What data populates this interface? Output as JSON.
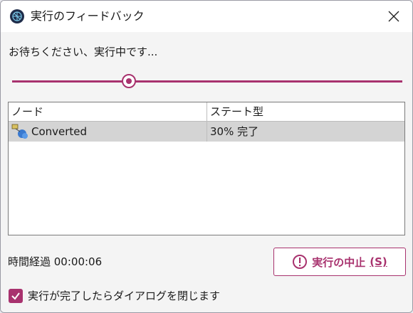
{
  "window": {
    "title": "実行のフィードバック",
    "app_icon": "globe-icon",
    "close_icon": "close-icon"
  },
  "message": "お待ちください、実行中です...",
  "progress": {
    "value": 0.3
  },
  "table": {
    "columns": [
      "ノード",
      "ステート型"
    ],
    "rows": [
      {
        "node": "Converted",
        "state": "30% 完了",
        "icon": "node-converted-icon"
      }
    ]
  },
  "elapsed": {
    "label": "時間経過 00:00:06"
  },
  "stop_button": {
    "label": "実行の中止",
    "shortcut": "(S)",
    "icon": "alert-circle-icon"
  },
  "checkbox": {
    "label": "実行が完了したらダイアログを閉じます",
    "checked": true
  },
  "colors": {
    "accent": "#a8326e",
    "row_selected": "#d4d4d4"
  }
}
